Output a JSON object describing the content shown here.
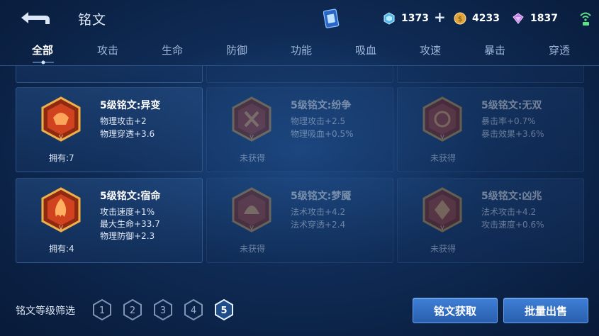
{
  "header": {
    "title": "铭文",
    "currency": [
      {
        "icon": "blue-crystal-icon",
        "value": "1373"
      },
      {
        "icon": "gold-coin-icon",
        "value": "4233"
      },
      {
        "icon": "purple-diamond-icon",
        "value": "1837"
      }
    ],
    "plus_label": "+"
  },
  "tabs": [
    "全部",
    "攻击",
    "生命",
    "防御",
    "功能",
    "吸血",
    "攻速",
    "暴击",
    "穿透"
  ],
  "active_tab": "全部",
  "top_row_partial": [
    "",
    "",
    ""
  ],
  "runes": [
    {
      "name": "5级铭文:异变",
      "stats": [
        "物理攻击+2",
        "物理穿透+3.6"
      ],
      "owned": "拥有:7",
      "obtained": true,
      "color": "#d1421f"
    },
    {
      "name": "5级铭文:纷争",
      "stats": [
        "物理攻击+2.5",
        "物理吸血+0.5%"
      ],
      "owned": "未获得",
      "obtained": false,
      "color": "#b8402a"
    },
    {
      "name": "5级铭文:无双",
      "stats": [
        "暴击率+0.7%",
        "暴击效果+3.6%"
      ],
      "owned": "未获得",
      "obtained": false,
      "color": "#b8402a"
    },
    {
      "name": "5级铭文:宿命",
      "stats": [
        "攻击速度+1%",
        "最大生命+33.7",
        "物理防御+2.3"
      ],
      "owned": "拥有:4",
      "obtained": true,
      "color": "#d1421f"
    },
    {
      "name": "5级铭文:梦魇",
      "stats": [
        "法术攻击+4.2",
        "法术穿透+2.4"
      ],
      "owned": "未获得",
      "obtained": false,
      "color": "#b8402a"
    },
    {
      "name": "5级铭文:凶兆",
      "stats": [
        "法术攻击+4.2",
        "攻击速度+0.6%"
      ],
      "owned": "未获得",
      "obtained": false,
      "color": "#b8402a"
    }
  ],
  "filter": {
    "label": "铭文等级筛选",
    "levels": [
      "1",
      "2",
      "3",
      "4",
      "5"
    ],
    "selected": "5"
  },
  "buttons": {
    "acquire": "铭文获取",
    "bulk_sell": "批量出售"
  }
}
